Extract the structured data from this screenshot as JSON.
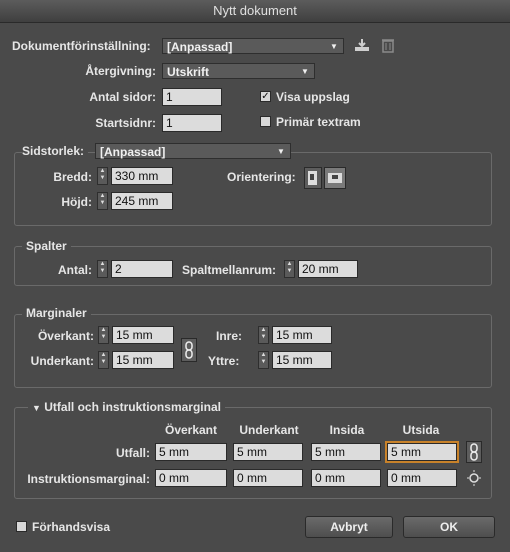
{
  "window": {
    "title": "Nytt dokument"
  },
  "preset": {
    "label": "Dokumentförinställning:",
    "value": "[Anpassad]"
  },
  "intent": {
    "label": "Återgivning:",
    "value": "Utskrift"
  },
  "pages": {
    "label": "Antal sidor:",
    "value": "1"
  },
  "start": {
    "label": "Startsidnr:",
    "value": "1"
  },
  "facing": {
    "label": "Visa uppslag",
    "checked": true
  },
  "primary": {
    "label": "Primär textram",
    "checked": false
  },
  "pagesize": {
    "label": "Sidstorlek:",
    "value": "[Anpassad]",
    "width_label": "Bredd:",
    "width": "330 mm",
    "height_label": "Höjd:",
    "height": "245 mm",
    "orientation_label": "Orientering:"
  },
  "columns": {
    "legend": "Spalter",
    "number_label": "Antal:",
    "number": "2",
    "gutter_label": "Spaltmellanrum:",
    "gutter": "20 mm"
  },
  "margins": {
    "legend": "Marginaler",
    "top_label": "Överkant:",
    "top": "15 mm",
    "bottom_label": "Underkant:",
    "bottom": "15 mm",
    "inside_label": "Inre:",
    "inside": "15 mm",
    "outside_label": "Yttre:",
    "outside": "15 mm"
  },
  "bleed": {
    "legend": "Utfall och instruktionsmarginal",
    "headers": [
      "Överkant",
      "Underkant",
      "Insida",
      "Utsida"
    ],
    "bleed_label": "Utfall:",
    "bleed_values": [
      "5 mm",
      "5 mm",
      "5 mm",
      "5 mm"
    ],
    "slug_label": "Instruktionsmarginal:",
    "slug_values": [
      "0 mm",
      "0 mm",
      "0 mm",
      "0 mm"
    ]
  },
  "footer": {
    "preview_label": "Förhandsvisa",
    "cancel": "Avbryt",
    "ok": "OK"
  },
  "colors": {
    "background": "#4a4a4a",
    "focus": "#c8822a"
  }
}
